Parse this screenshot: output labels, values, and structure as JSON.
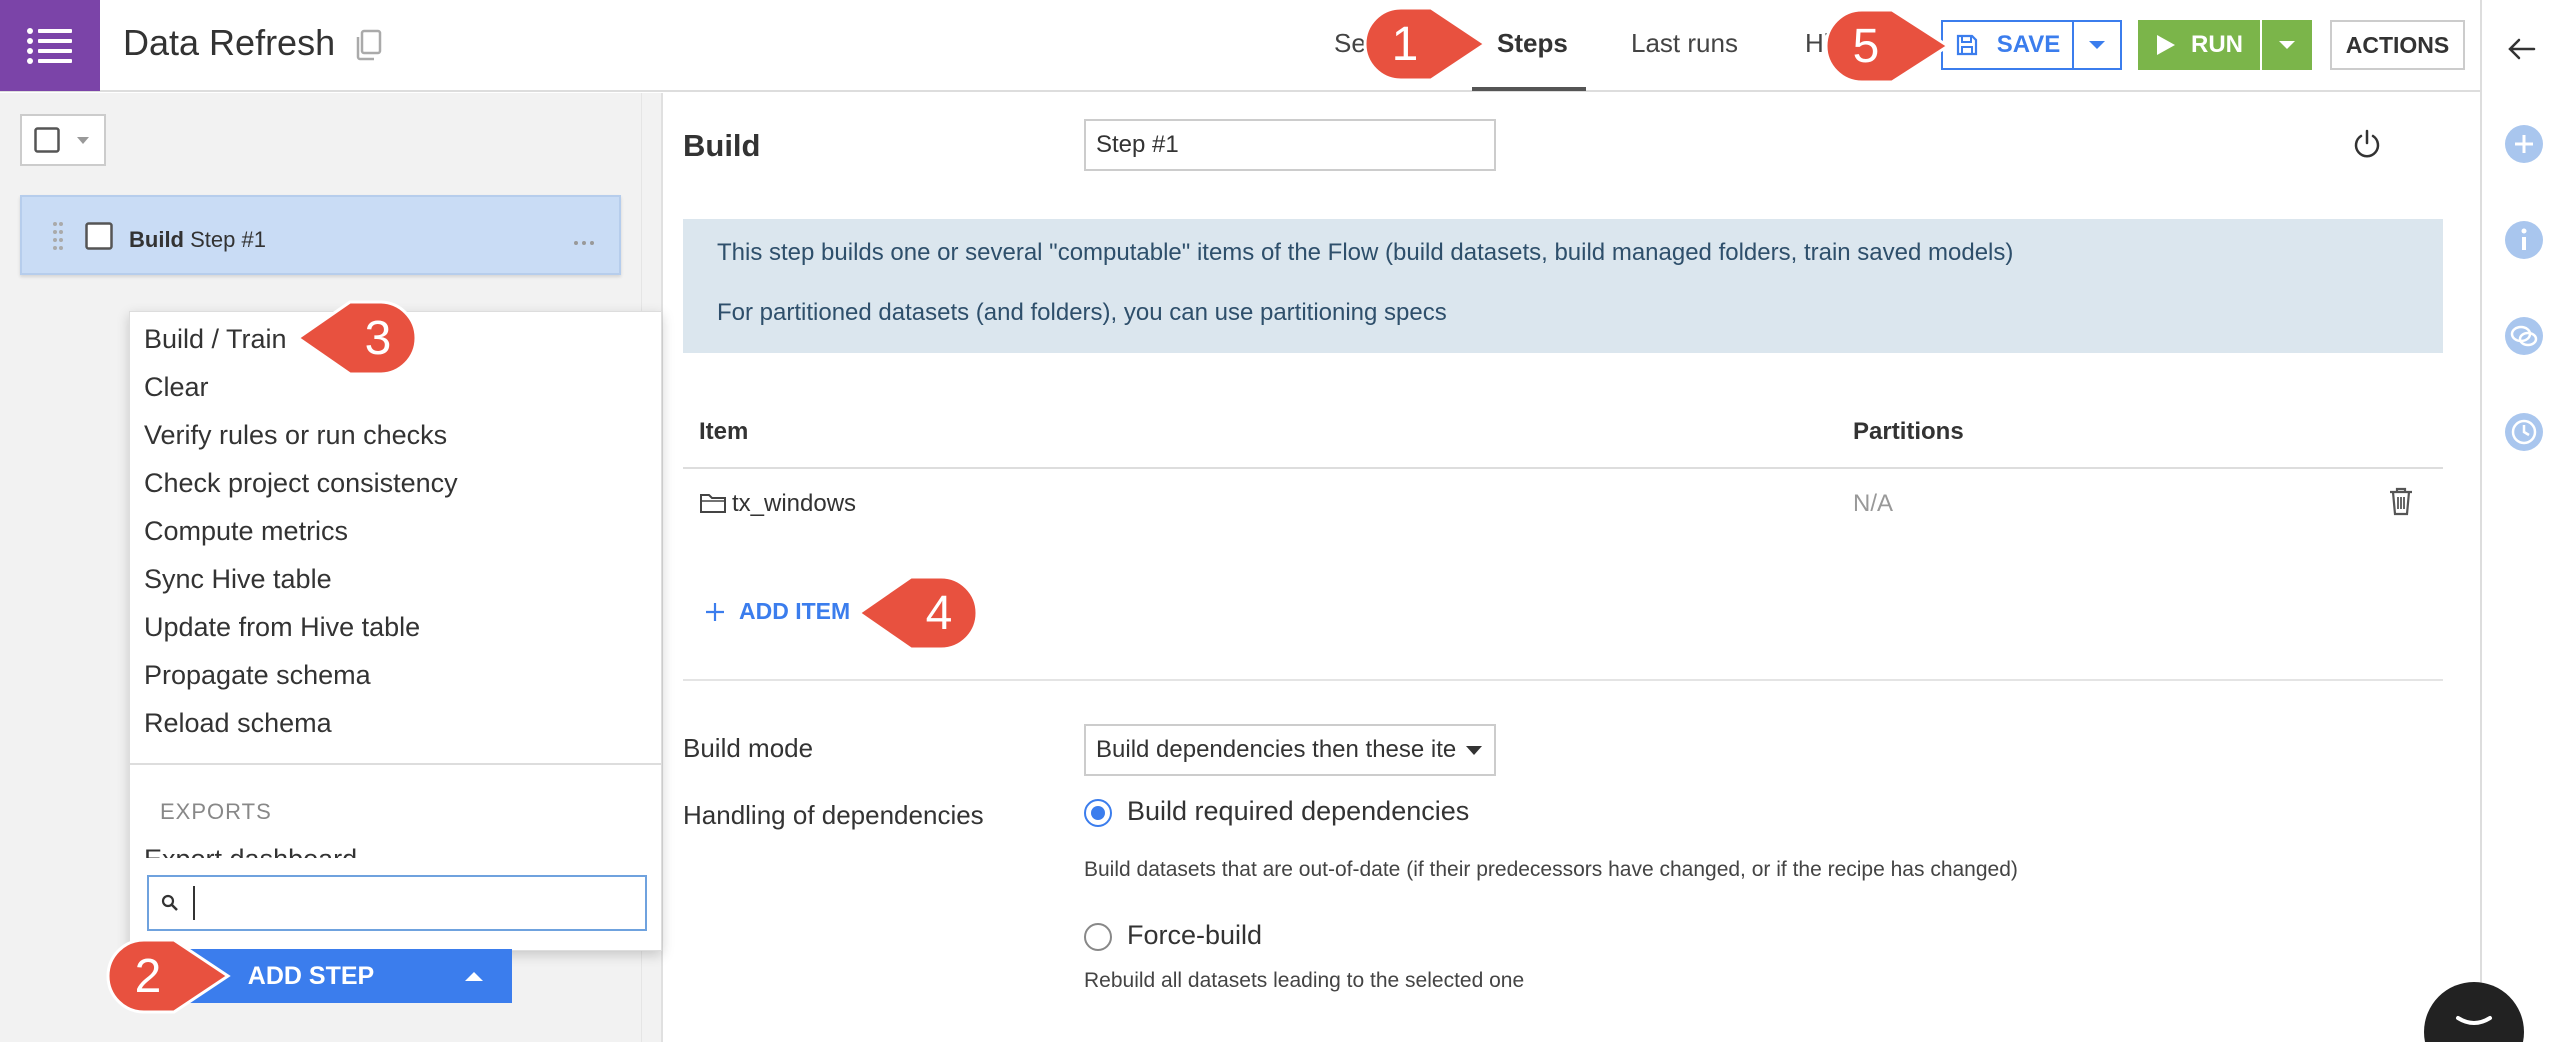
{
  "header": {
    "project_title": "Data Refresh",
    "tabs": [
      {
        "label": "Se"
      },
      {
        "label": "Steps"
      },
      {
        "label": "Last runs"
      },
      {
        "label": "Hi"
      }
    ],
    "save_label": "SAVE",
    "run_label": "RUN",
    "actions_label": "ACTIONS"
  },
  "sidebar": {
    "step": {
      "bold": "Build",
      "name": "Step #1"
    }
  },
  "step_menu": {
    "items": [
      "Build / Train",
      "Clear",
      "Verify rules or run checks",
      "Check project consistency",
      "Compute metrics",
      "Sync Hive table",
      "Update from Hive table",
      "Propagate schema",
      "Reload schema"
    ],
    "section_label": "EXPORTS",
    "cut_item": "Export dashboard",
    "search_value": ""
  },
  "add_step_label": "ADD STEP",
  "main": {
    "heading": "Build",
    "step_name": "Step #1",
    "info_lines": [
      "This step builds one or several \"computable\" items of the Flow (build datasets, build managed folders, train saved models)",
      "For partitioned datasets (and folders), you can use partitioning specs"
    ],
    "table": {
      "col_item": "Item",
      "col_partitions": "Partitions",
      "rows": [
        {
          "name": "tx_windows",
          "partitions": "N/A",
          "icon": "folder-icon"
        }
      ]
    },
    "add_item_label": "ADD ITEM",
    "build_mode_label": "Build mode",
    "build_mode_value": "Build dependencies then these ite",
    "dependencies_label": "Handling of dependencies",
    "options": [
      {
        "label": "Build required dependencies",
        "help": "Build datasets that are out-of-date (if their predecessors have changed, or if the recipe has changed)",
        "checked": true
      },
      {
        "label": "Force-build",
        "help": "Rebuild all datasets leading to the selected one",
        "checked": false
      }
    ]
  },
  "callouts": [
    "1",
    "2",
    "3",
    "4",
    "5"
  ],
  "colors": {
    "brand_purple": "#7b44a8",
    "primary_blue": "#3b7ded",
    "run_green": "#7bb54a",
    "callout_red": "#e8513f",
    "info_bg": "#dbe6ee",
    "selected_step_bg": "#c9dcf5"
  },
  "icons": [
    "menu-icon",
    "copy-icon",
    "save-disk-icon",
    "play-icon",
    "back-arrow-icon",
    "plus-circle-icon",
    "info-circle-icon",
    "discussion-icon",
    "history-icon",
    "drag-handle-icon",
    "more-dots-icon",
    "search-icon",
    "power-icon",
    "folder-icon",
    "trash-icon",
    "plus-icon",
    "chat-icon"
  ]
}
